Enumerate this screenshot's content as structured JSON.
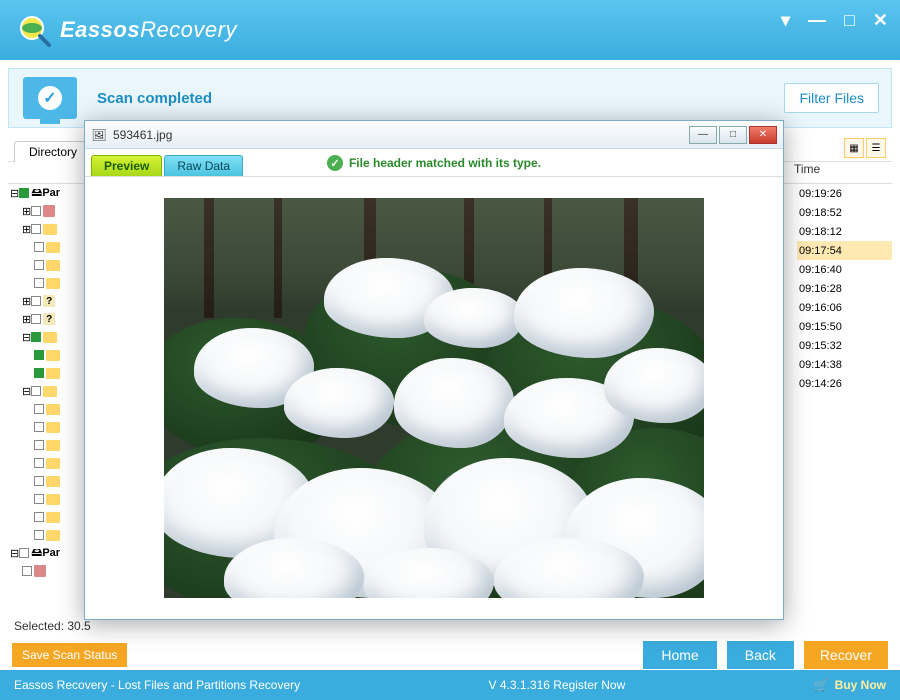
{
  "app": {
    "name_bold": "Eassos",
    "name_light": "Recovery"
  },
  "window_controls": {
    "menu": "▾",
    "min": "—",
    "max": "□",
    "close": "✕"
  },
  "status": {
    "text": "Scan completed",
    "filter_button": "Filter Files"
  },
  "tabs": {
    "directory": "Directory"
  },
  "columns": {
    "time": "Time"
  },
  "tree": {
    "root_label": "Par",
    "root2_label": "Par"
  },
  "rows": [
    {
      "time": "09:19:26"
    },
    {
      "time": "09:18:52"
    },
    {
      "time": "09:18:12"
    },
    {
      "time": "09:17:54",
      "selected": true
    },
    {
      "time": "09:16:40"
    },
    {
      "time": "09:16:28"
    },
    {
      "time": "09:16:06"
    },
    {
      "time": "09:15:50"
    },
    {
      "time": "09:15:32"
    },
    {
      "time": "09:14:38"
    },
    {
      "time": "09:14:26"
    }
  ],
  "selected_text": "Selected: 30.5",
  "bottom": {
    "save_scan": "Save Scan Status",
    "home": "Home",
    "back": "Back",
    "recover": "Recover"
  },
  "footer": {
    "tagline": "Eassos Recovery - Lost Files and Partitions Recovery",
    "version": "V 4.3.1.316  Register Now",
    "buy": "Buy Now"
  },
  "preview": {
    "title": "593461.jpg",
    "tab_preview": "Preview",
    "tab_raw": "Raw Data",
    "match_msg": "File header matched with its type."
  }
}
